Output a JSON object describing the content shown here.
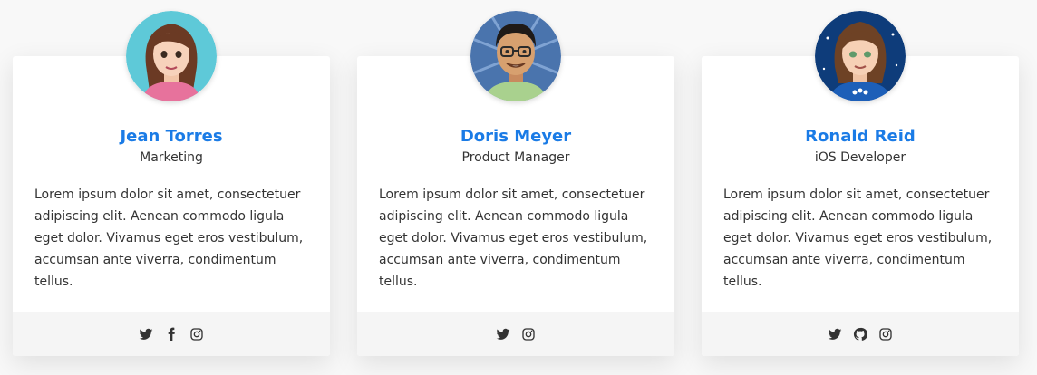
{
  "accent_color": "#1a7be6",
  "team": [
    {
      "name": "Jean Torres",
      "role": "Marketing",
      "bio": "Lorem ipsum dolor sit amet, consectetuer adipiscing elit. Aenean commodo ligula eget dolor. Vivamus eget eros vestibulum, accumsan ante viverra, condimentum tellus.",
      "socials": [
        "twitter-icon",
        "facebook-icon",
        "instagram-icon"
      ]
    },
    {
      "name": "Doris Meyer",
      "role": "Product Manager",
      "bio": "Lorem ipsum dolor sit amet, consectetuer adipiscing elit. Aenean commodo ligula eget dolor. Vivamus eget eros vestibulum, accumsan ante viverra, condimentum tellus.",
      "socials": [
        "twitter-icon",
        "instagram-icon"
      ]
    },
    {
      "name": "Ronald Reid",
      "role": "iOS Developer",
      "bio": "Lorem ipsum dolor sit amet, consectetuer adipiscing elit. Aenean commodo ligula eget dolor. Vivamus eget eros vestibulum, accumsan ante viverra, condimentum tellus.",
      "socials": [
        "twitter-icon",
        "github-icon",
        "instagram-icon"
      ]
    }
  ]
}
